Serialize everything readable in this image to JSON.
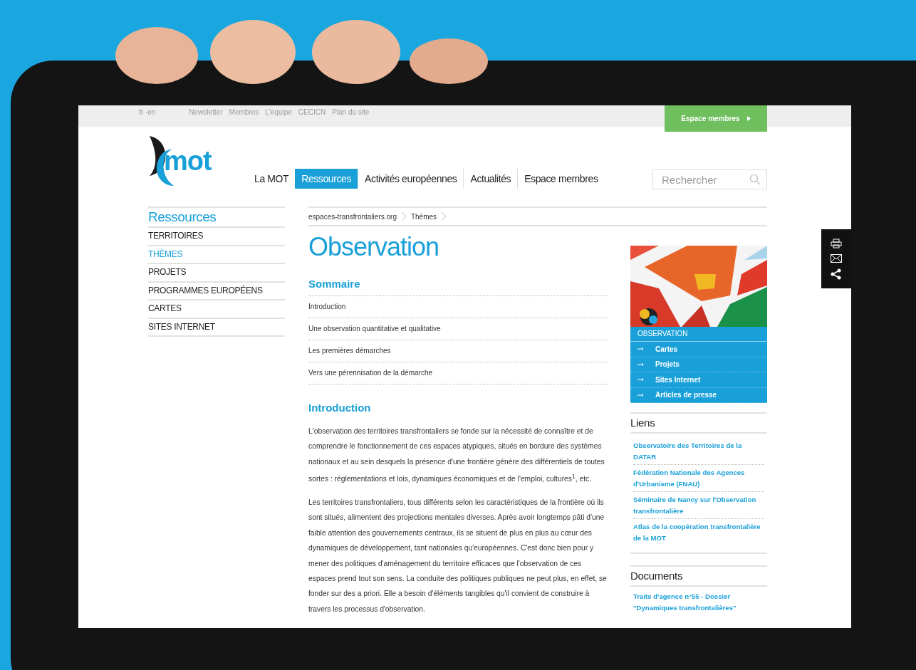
{
  "top_bar": {
    "language": "fr -en",
    "links": [
      "Newsletter",
      "Membres",
      "L'equipe",
      "CECICN",
      "Plan du site"
    ],
    "member_button": "Espace membres"
  },
  "logo": {
    "text": "mot"
  },
  "nav": {
    "items": [
      {
        "label": "La MOT",
        "selected": false
      },
      {
        "label": "Ressources",
        "selected": true
      },
      {
        "label": "Activités européennes",
        "selected": false
      },
      {
        "label": "Actualités",
        "selected": false
      },
      {
        "label": "Espace membres",
        "selected": false
      }
    ]
  },
  "search": {
    "placeholder": "Rechercher"
  },
  "sidebar": {
    "title": "Ressources",
    "items": [
      {
        "label": "TERRITOIRES",
        "selected": false
      },
      {
        "label": "THÈMES",
        "selected": true
      },
      {
        "label": "PROJETS",
        "selected": false
      },
      {
        "label": "PROGRAMMES EUROPÉENS",
        "selected": false
      },
      {
        "label": "CARTES",
        "selected": false
      },
      {
        "label": "SITES INTERNET",
        "selected": false
      }
    ]
  },
  "breadcrumb": [
    "espaces-transfrontaliers.org",
    "Thèmes"
  ],
  "page_title": "Observation",
  "summary": {
    "title": "Sommaire",
    "items": [
      "Introduction",
      "Une observation quantitative et qualitative",
      "Les premières démarches",
      "Vers une pérennisation de la démarche"
    ]
  },
  "section": {
    "title": "Introduction",
    "paragraphs": [
      "L'observation des territoires transfrontaliers se fonde sur la nécessité de connaître et de comprendre le fonctionnement de ces espaces atypiques, situés en bordure des systèmes nationaux et au sein desquels la présence d'une frontière génère des différentiels de toutes sortes : réglementations et lois, dynamiques économiques et de l'emploi, cultures$^{1}$, etc.",
      "Les territoires transfrontaliers, tous différents selon les caractéristiques de la frontière où ils sont situés, alimentent des projections mentales diverses. Après avoir longtemps pâti d'une faible attention des gouvernements centraux, ils se situent de plus en plus au cœur des dynamiques de développement, tant nationales qu'européennes. C'est donc bien pour y mener des politiques d'aménagement du territoire efficaces que l'observation de ces espaces prend tout son sens. La conduite des politiques publiques ne peut plus, en effet, se fonder sur des a priori. Elle a besoin d'éléments tangibles qu'il convient de construire à travers les processus d'observation."
    ]
  },
  "theme_box": {
    "title": "OBSERVATION",
    "items": [
      "Cartes",
      "Projets",
      "Sites Internet",
      "Articles de presse"
    ]
  },
  "links_box": {
    "title": "Liens",
    "items": [
      "Observatoire des Territoires de la DATAR",
      "Fédération Nationale des Agences d'Urbanisme (FNAU)",
      "Séminaire de Nancy sur l'Observation transfrontalière",
      "Atlas de la coopération transfrontalière de la MOT"
    ]
  },
  "documents_box": {
    "title": "Documents",
    "items": [
      "Traits d'agence n°55 - Dossier \"Dynamiques transfrontalières\""
    ]
  }
}
